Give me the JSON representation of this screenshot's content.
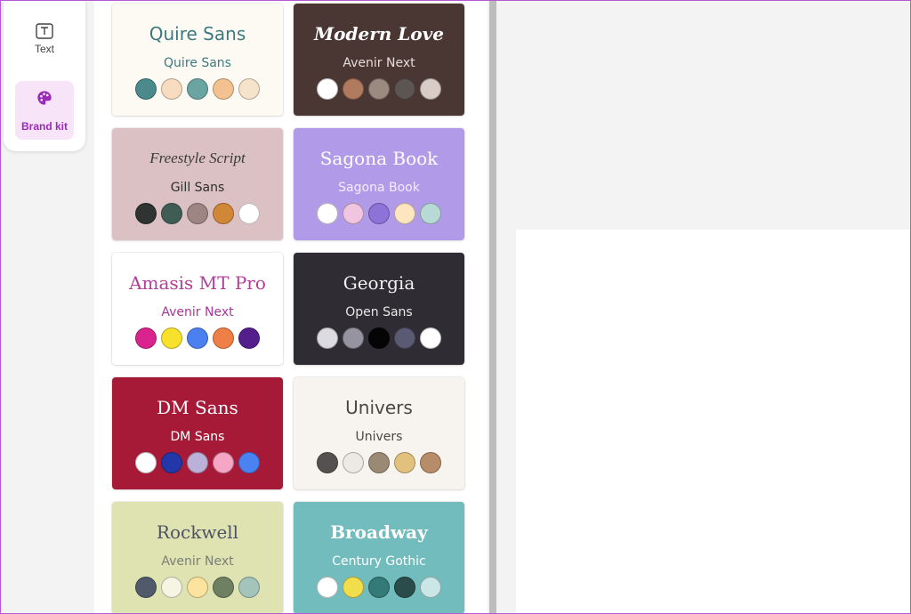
{
  "rail": {
    "items": [
      {
        "label": "Text",
        "icon": "text-box-icon"
      },
      {
        "label": "Brand kit",
        "icon": "palette-icon"
      }
    ]
  },
  "kits": [
    {
      "heading": "Quire Sans",
      "body": "Quire Sans",
      "bg": "#fdfaf3",
      "heading_color": "#3c7a80",
      "body_color": "#3c7a80",
      "heading_style": "sans",
      "swatches": [
        "#4a8a8c",
        "#f8dcbf",
        "#6aa5a3",
        "#f4c290",
        "#f5e3cc"
      ]
    },
    {
      "heading": "Modern Love",
      "body": "Avenir Next",
      "bg": "#4a3632",
      "heading_color": "#ffffff",
      "body_color": "#e6dcd8",
      "heading_style": "script-bold",
      "swatches": [
        "#ffffff",
        "#b07a5e",
        "#9a8a80",
        "#5c5552",
        "#d9ccc6"
      ]
    },
    {
      "heading": "Freestyle Script",
      "body": "Gill Sans",
      "bg": "#dbc1c3",
      "heading_color": "#3a3a3a",
      "body_color": "#2f2f2f",
      "heading_style": "script",
      "swatches": [
        "#2f3433",
        "#3f5d55",
        "#9c8582",
        "#d18738",
        "#ffffff"
      ]
    },
    {
      "heading": "Sagona Book",
      "body": "Sagona Book",
      "bg": "#b19be8",
      "heading_color": "#ffffff",
      "body_color": "#f4ecff",
      "heading_style": "serif",
      "swatches": [
        "#ffffff",
        "#efc5e0",
        "#8d72d8",
        "#fde6bf",
        "#b8dad6"
      ]
    },
    {
      "heading": "Amasis MT Pro",
      "body": "Avenir Next",
      "bg": "#ffffff",
      "heading_color": "#b0409a",
      "body_color": "#a8379a",
      "heading_style": "serif",
      "swatches": [
        "#d9248e",
        "#f7e12b",
        "#4a80f0",
        "#ef7f47",
        "#541e8d"
      ]
    },
    {
      "heading": "Georgia",
      "body": "Open Sans",
      "bg": "#2f2c33",
      "heading_color": "#f2f2f2",
      "body_color": "#e8e8e8",
      "heading_style": "serif",
      "swatches": [
        "#dcdce0",
        "#9694a0",
        "#050505",
        "#5b5a75",
        "#ffffff"
      ]
    },
    {
      "heading": "DM Sans",
      "body": "DM Sans",
      "bg": "#a61a38",
      "heading_color": "#ffffff",
      "body_color": "#ffffff",
      "heading_style": "serif",
      "swatches": [
        "#ffffff",
        "#2337a8",
        "#bbb0d8",
        "#f4a6c4",
        "#4a82f2"
      ]
    },
    {
      "heading": "Univers",
      "body": "Univers",
      "bg": "#f7f4ef",
      "heading_color": "#4a4646",
      "body_color": "#4a4646",
      "heading_style": "sans",
      "swatches": [
        "#555150",
        "#edeae4",
        "#9a8a74",
        "#e2c17e",
        "#b78c68"
      ]
    },
    {
      "heading": "Rockwell",
      "body": "Avenir Next",
      "bg": "#dfe3b1",
      "heading_color": "#4d5264",
      "body_color": "#7a7e76",
      "heading_style": "serif",
      "swatches": [
        "#505a6a",
        "#f6f4e2",
        "#fde49e",
        "#6e7f62",
        "#a3c4bb"
      ]
    },
    {
      "heading": "Broadway",
      "body": "Century Gothic",
      "bg": "#72bcbd",
      "heading_color": "#ffffff",
      "body_color": "#ffffff",
      "heading_style": "display",
      "swatches": [
        "#ffffff",
        "#f2dd4d",
        "#337a78",
        "#2a4c4a",
        "#cbe6e6"
      ]
    }
  ]
}
